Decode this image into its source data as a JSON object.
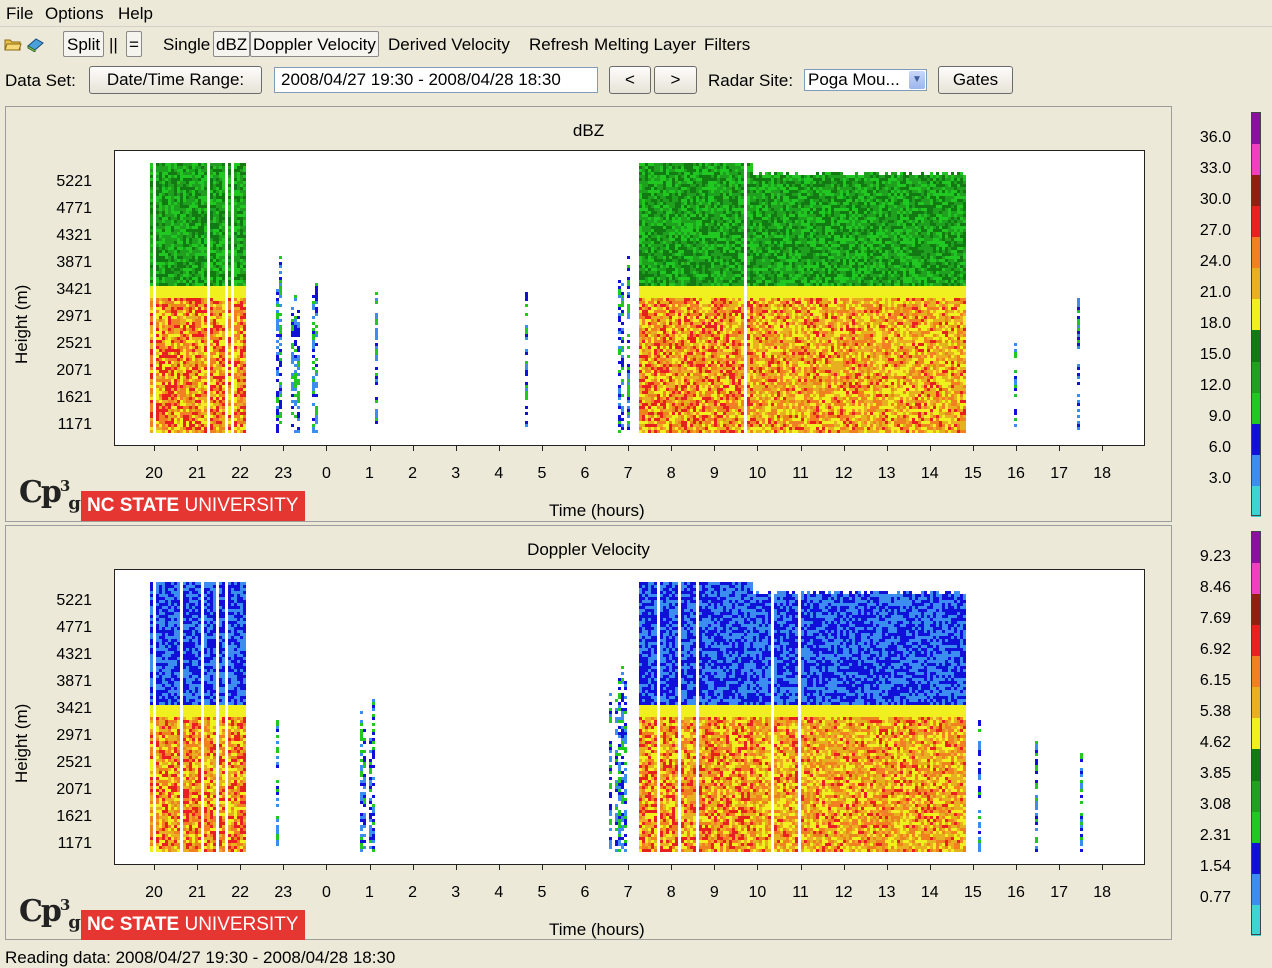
{
  "menu": [
    "File",
    "Options",
    "Help"
  ],
  "toolbar": {
    "split": "Split",
    "vertical": "||",
    "horizontal": "=",
    "single": "Single",
    "dbz": "dBZ",
    "doppler": "Doppler Velocity",
    "derived": "Derived Velocity",
    "refresh": "Refresh",
    "melting": "Melting Layer",
    "filters": "Filters",
    "icons": [
      "open-folder-icon",
      "book-icon"
    ]
  },
  "dataset": {
    "label": "Data Set:",
    "datetime_button": "Date/Time Range:",
    "range_value": "2008/04/27 19:30 - 2008/04/28 18:30",
    "prev": "<",
    "next": ">",
    "radar_label": "Radar Site:",
    "radar_value": "Poga Mou...",
    "gates": "Gates"
  },
  "branding": {
    "cp_logo": "Cp",
    "cp_sup": "3",
    "cp_sub": "g",
    "university_bold": "NC STATE",
    "university_rest": " UNIVERSITY"
  },
  "chart_data": [
    {
      "type": "heatmap",
      "title": "dBZ",
      "xlabel": "Time (hours)",
      "ylabel": "Height (m)",
      "x_ticks": [
        "20",
        "21",
        "22",
        "23",
        "0",
        "1",
        "2",
        "3",
        "4",
        "5",
        "6",
        "7",
        "8",
        "9",
        "10",
        "11",
        "12",
        "13",
        "14",
        "15",
        "16",
        "17",
        "18"
      ],
      "y_ticks": [
        "5221",
        "4771",
        "4321",
        "3871",
        "3421",
        "2971",
        "2521",
        "2071",
        "1621",
        "1171"
      ],
      "colorbar_ticks": [
        "36.0",
        "33.0",
        "30.0",
        "27.0",
        "24.0",
        "21.0",
        "18.0",
        "15.0",
        "12.0",
        "9.0",
        "6.0",
        "3.0"
      ],
      "colors": [
        "#3fd4d4",
        "#3b8ef0",
        "#1010d8",
        "#22c822",
        "#1fa01f",
        "#137a13",
        "#f0f020",
        "#e8b020",
        "#f08020",
        "#e82020",
        "#902010",
        "#f040c0",
        "#8a10a0"
      ]
    },
    {
      "type": "heatmap",
      "title": "Doppler Velocity",
      "xlabel": "Time (hours)",
      "ylabel": "Height (m)",
      "x_ticks": [
        "20",
        "21",
        "22",
        "23",
        "0",
        "1",
        "2",
        "3",
        "4",
        "5",
        "6",
        "7",
        "8",
        "9",
        "10",
        "11",
        "12",
        "13",
        "14",
        "15",
        "16",
        "17",
        "18"
      ],
      "y_ticks": [
        "5221",
        "4771",
        "4321",
        "3871",
        "3421",
        "2971",
        "2521",
        "2071",
        "1621",
        "1171"
      ],
      "colorbar_ticks": [
        "9.23",
        "8.46",
        "7.69",
        "6.92",
        "6.15",
        "5.38",
        "4.62",
        "3.85",
        "3.08",
        "2.31",
        "1.54",
        "0.77"
      ],
      "colors": [
        "#3fd4d4",
        "#3b8ef0",
        "#1010d8",
        "#22c822",
        "#1fa01f",
        "#137a13",
        "#f0f020",
        "#e8b020",
        "#f08020",
        "#e82020",
        "#902010",
        "#f040c0",
        "#8a10a0"
      ]
    }
  ],
  "status": "Reading data: 2008/04/27 19:30 - 2008/04/28 18:30"
}
